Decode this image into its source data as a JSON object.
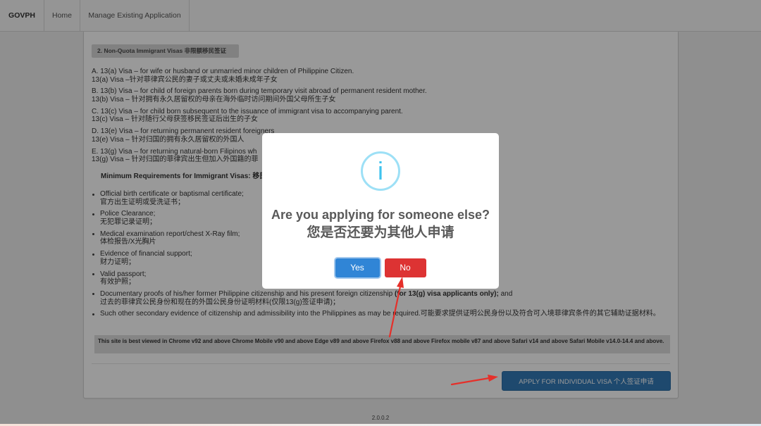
{
  "navbar": {
    "brand": "GOVPH",
    "items": [
      {
        "label": "Home"
      },
      {
        "label": "Manage Existing Application"
      }
    ]
  },
  "content": {
    "section_badge": "2. Non-Quota Immigrant Visas 非限额移民签证",
    "visa_types": [
      {
        "en": "A. 13(a) Visa – for wife or husband or unmarried minor children of Philippine Citizen.",
        "zh": "13(a) Visa –针对菲律宾公民的妻子或丈夫或未婚未成年子女"
      },
      {
        "en": "B. 13(b) Visa – for child of foreign parents born during temporary visit abroad of permanent resident mother.",
        "zh": "13(b) Visa – 针对拥有永久居留权的母亲在海外临时访问期间外国父母所生子女"
      },
      {
        "en": "C. 13(c) Visa – for child born subsequent to the issuance of immigrant visa to accompanying parent.",
        "zh": "13(c) Visa – 针对随行父母获签移民签证后出生的子女"
      },
      {
        "en": "D. 13(e) Visa – for returning permanent resident foreigners",
        "zh": "13(e) Visa – 针对归国的拥有永久居留权的外国人"
      },
      {
        "en": "E. 13(g) Visa – for returning natural-born Filipinos wh",
        "zh": "13(g) Visa – 针对归国的菲律宾出生但加入外国籍的菲"
      }
    ],
    "requirements_heading": "Minimum Requirements for Immigrant Visas: 移民",
    "requirements": [
      {
        "en": "Official birth certificate or baptismal certificate;",
        "zh": "官方出生证明或受洗证书；"
      },
      {
        "en": "Police Clearance;",
        "zh": "无犯罪记录证明；"
      },
      {
        "en": "Medical examination report/chest X-Ray film;",
        "zh": "体检报告/X光胸片"
      },
      {
        "en": "Evidence of financial support;",
        "zh": "财力证明；"
      },
      {
        "en": "Valid passport;",
        "zh": "有效护照；"
      },
      {
        "en": "Documentary proofs of his/her former Philippine citizenship and his present foreign citizenship ",
        "en_bold": "(for 13(g) visa applicants only);",
        "en_tail": " and",
        "zh": "过去的菲律宾公民身份和现在的外国公民身份证明材料(仅限13(g)签证申请)；"
      },
      {
        "en": "Such other secondary evidence of citizenship and admissibility into the Philippines as may be required.可能要求提供证明公民身份以及符合可入境菲律宾条件的其它辅助证据材料。"
      }
    ],
    "browser_note": "This site is best viewed in Chrome v92 and above Chrome Mobile v90 and above Edge v89 and above Firefox v88 and above Firefox mobile v87 and above Safari v14 and above Safari Mobile v14.0-14.4 and above.",
    "apply_button": "APPLY FOR INDIVIDUAL VISA 个人签证申请"
  },
  "footer": {
    "version": "2.0.0.2"
  },
  "modal": {
    "icon": "info-icon",
    "icon_glyph": "i",
    "title": "Are you applying for someone else?",
    "title_zh": "您是否还要为其他人申请",
    "confirm_label": "Yes",
    "cancel_label": "No"
  },
  "colors": {
    "apply_button": "#337ab7",
    "confirm_button": "#3085d6",
    "cancel_button": "#dd3333",
    "info_icon": "#3fc3ee",
    "info_icon_ring": "#9de0f6",
    "annotation_arrow": "#e5302a"
  }
}
